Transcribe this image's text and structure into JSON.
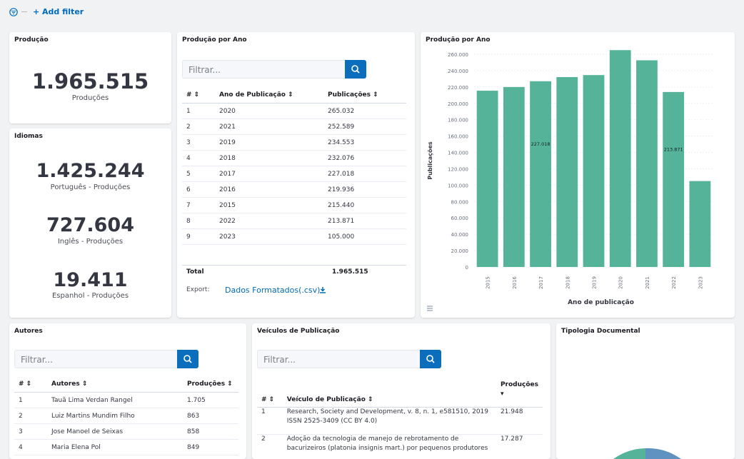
{
  "topbar": {
    "add_filter_label": "+ Add filter"
  },
  "producao": {
    "title": "Produção",
    "value": "1.965.515",
    "label": "Produções"
  },
  "idiomas": {
    "title": "Idiomas",
    "metrics": [
      {
        "value": "1.425.244",
        "label": "Português - Produções"
      },
      {
        "value": "727.604",
        "label": "Inglês - Produções"
      },
      {
        "value": "19.411",
        "label": "Espanhol - Produções"
      }
    ]
  },
  "producao_ano_table": {
    "title": "Produção por Ano",
    "search_placeholder": "Filtrar...",
    "headers": [
      "# ⇕",
      "Ano de Publicação ⇕",
      "Publicações ⇕"
    ],
    "rows": [
      [
        "1",
        "2020",
        "265.032"
      ],
      [
        "2",
        "2021",
        "252.589"
      ],
      [
        "3",
        "2019",
        "234.553"
      ],
      [
        "4",
        "2018",
        "232.076"
      ],
      [
        "5",
        "2017",
        "227.018"
      ],
      [
        "6",
        "2016",
        "219.936"
      ],
      [
        "7",
        "2015",
        "215.440"
      ],
      [
        "8",
        "2022",
        "213.871"
      ],
      [
        "9",
        "2023",
        "105.000"
      ]
    ],
    "total_label": "Total",
    "total_value": "1.965.515",
    "export_label": "Export:",
    "export_link": "Dados Formatados(.csv)"
  },
  "chart_data": {
    "type": "bar",
    "title": "Produção por Ano",
    "xlabel": "Ano de publicação",
    "ylabel": "Publicações",
    "categories": [
      "2015",
      "2016",
      "2017",
      "2018",
      "2019",
      "2020",
      "2021",
      "2022",
      "2023"
    ],
    "values": [
      215440,
      219936,
      227018,
      232076,
      234553,
      265032,
      252589,
      213871,
      105000
    ],
    "ylim": [
      0,
      260000
    ],
    "yticks": [
      "0",
      "20.000",
      "40.000",
      "60.000",
      "80.000",
      "100.000",
      "120.000",
      "140.000",
      "160.000",
      "180.000",
      "200.000",
      "220.000",
      "240.000",
      "260.000"
    ],
    "data_labels": {
      "2017": "227.018",
      "2022": "213.871"
    },
    "bar_color": "#54b399",
    "grid": true
  },
  "autores": {
    "title": "Autores",
    "search_placeholder": "Filtrar...",
    "headers": [
      "# ⇕",
      "Autores ⇕",
      "Produções ⇕"
    ],
    "rows": [
      [
        "1",
        "Tauã Lima Verdan Rangel",
        "1.705"
      ],
      [
        "2",
        "Luiz Martins Mundim Filho",
        "863"
      ],
      [
        "3",
        "Jose Manoel de Seixas",
        "858"
      ],
      [
        "4",
        "Maria Elena Pol",
        "849"
      ]
    ]
  },
  "veiculos": {
    "title": "Veículos de Publicação",
    "search_placeholder": "Filtrar...",
    "headers": [
      "# ⇕",
      "Veículo de Publicação ⇕",
      "Produções"
    ],
    "rows": [
      [
        "1",
        "Research, Society and Development, v. 8, n. 1, e581510, 2019 ISSN 2525-3409 (CC BY 4.0)",
        "21.948"
      ],
      [
        "2",
        "Adoção da tecnologia de manejo de rebrotamento de bacurizeiros (platonia insignis mart.) por pequenos produtores",
        "17.287"
      ]
    ]
  },
  "tipologia": {
    "title": "Tipologia Documental"
  },
  "colors": {
    "accent": "#0a6ebd",
    "bar": "#54b399",
    "pie_a": "#54b399",
    "pie_b": "#6092c0"
  }
}
